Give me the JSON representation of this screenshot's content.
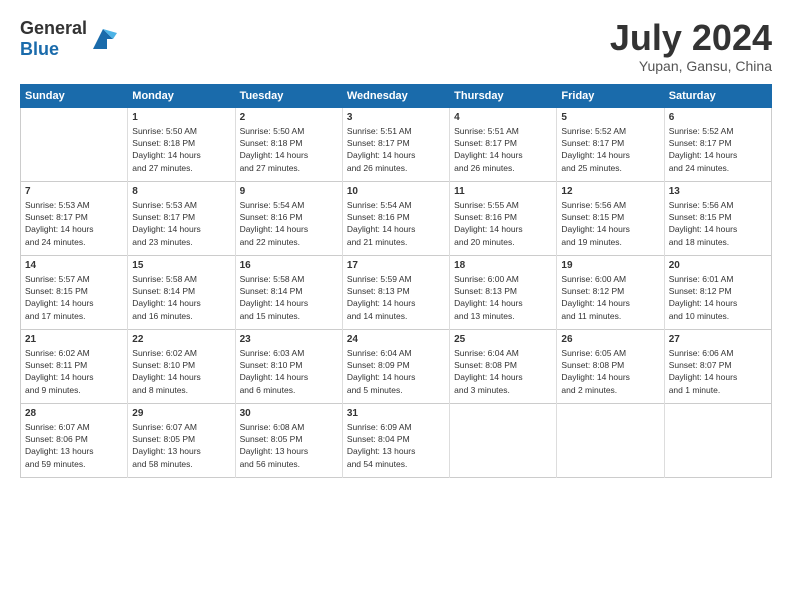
{
  "header": {
    "logo_general": "General",
    "logo_blue": "Blue",
    "month": "July 2024",
    "location": "Yupan, Gansu, China"
  },
  "weekdays": [
    "Sunday",
    "Monday",
    "Tuesday",
    "Wednesday",
    "Thursday",
    "Friday",
    "Saturday"
  ],
  "rows": [
    [
      {
        "day": "",
        "info": ""
      },
      {
        "day": "1",
        "info": "Sunrise: 5:50 AM\nSunset: 8:18 PM\nDaylight: 14 hours\nand 27 minutes."
      },
      {
        "day": "2",
        "info": "Sunrise: 5:50 AM\nSunset: 8:18 PM\nDaylight: 14 hours\nand 27 minutes."
      },
      {
        "day": "3",
        "info": "Sunrise: 5:51 AM\nSunset: 8:17 PM\nDaylight: 14 hours\nand 26 minutes."
      },
      {
        "day": "4",
        "info": "Sunrise: 5:51 AM\nSunset: 8:17 PM\nDaylight: 14 hours\nand 26 minutes."
      },
      {
        "day": "5",
        "info": "Sunrise: 5:52 AM\nSunset: 8:17 PM\nDaylight: 14 hours\nand 25 minutes."
      },
      {
        "day": "6",
        "info": "Sunrise: 5:52 AM\nSunset: 8:17 PM\nDaylight: 14 hours\nand 24 minutes."
      }
    ],
    [
      {
        "day": "7",
        "info": "Sunrise: 5:53 AM\nSunset: 8:17 PM\nDaylight: 14 hours\nand 24 minutes."
      },
      {
        "day": "8",
        "info": "Sunrise: 5:53 AM\nSunset: 8:17 PM\nDaylight: 14 hours\nand 23 minutes."
      },
      {
        "day": "9",
        "info": "Sunrise: 5:54 AM\nSunset: 8:16 PM\nDaylight: 14 hours\nand 22 minutes."
      },
      {
        "day": "10",
        "info": "Sunrise: 5:54 AM\nSunset: 8:16 PM\nDaylight: 14 hours\nand 21 minutes."
      },
      {
        "day": "11",
        "info": "Sunrise: 5:55 AM\nSunset: 8:16 PM\nDaylight: 14 hours\nand 20 minutes."
      },
      {
        "day": "12",
        "info": "Sunrise: 5:56 AM\nSunset: 8:15 PM\nDaylight: 14 hours\nand 19 minutes."
      },
      {
        "day": "13",
        "info": "Sunrise: 5:56 AM\nSunset: 8:15 PM\nDaylight: 14 hours\nand 18 minutes."
      }
    ],
    [
      {
        "day": "14",
        "info": "Sunrise: 5:57 AM\nSunset: 8:15 PM\nDaylight: 14 hours\nand 17 minutes."
      },
      {
        "day": "15",
        "info": "Sunrise: 5:58 AM\nSunset: 8:14 PM\nDaylight: 14 hours\nand 16 minutes."
      },
      {
        "day": "16",
        "info": "Sunrise: 5:58 AM\nSunset: 8:14 PM\nDaylight: 14 hours\nand 15 minutes."
      },
      {
        "day": "17",
        "info": "Sunrise: 5:59 AM\nSunset: 8:13 PM\nDaylight: 14 hours\nand 14 minutes."
      },
      {
        "day": "18",
        "info": "Sunrise: 6:00 AM\nSunset: 8:13 PM\nDaylight: 14 hours\nand 13 minutes."
      },
      {
        "day": "19",
        "info": "Sunrise: 6:00 AM\nSunset: 8:12 PM\nDaylight: 14 hours\nand 11 minutes."
      },
      {
        "day": "20",
        "info": "Sunrise: 6:01 AM\nSunset: 8:12 PM\nDaylight: 14 hours\nand 10 minutes."
      }
    ],
    [
      {
        "day": "21",
        "info": "Sunrise: 6:02 AM\nSunset: 8:11 PM\nDaylight: 14 hours\nand 9 minutes."
      },
      {
        "day": "22",
        "info": "Sunrise: 6:02 AM\nSunset: 8:10 PM\nDaylight: 14 hours\nand 8 minutes."
      },
      {
        "day": "23",
        "info": "Sunrise: 6:03 AM\nSunset: 8:10 PM\nDaylight: 14 hours\nand 6 minutes."
      },
      {
        "day": "24",
        "info": "Sunrise: 6:04 AM\nSunset: 8:09 PM\nDaylight: 14 hours\nand 5 minutes."
      },
      {
        "day": "25",
        "info": "Sunrise: 6:04 AM\nSunset: 8:08 PM\nDaylight: 14 hours\nand 3 minutes."
      },
      {
        "day": "26",
        "info": "Sunrise: 6:05 AM\nSunset: 8:08 PM\nDaylight: 14 hours\nand 2 minutes."
      },
      {
        "day": "27",
        "info": "Sunrise: 6:06 AM\nSunset: 8:07 PM\nDaylight: 14 hours\nand 1 minute."
      }
    ],
    [
      {
        "day": "28",
        "info": "Sunrise: 6:07 AM\nSunset: 8:06 PM\nDaylight: 13 hours\nand 59 minutes."
      },
      {
        "day": "29",
        "info": "Sunrise: 6:07 AM\nSunset: 8:05 PM\nDaylight: 13 hours\nand 58 minutes."
      },
      {
        "day": "30",
        "info": "Sunrise: 6:08 AM\nSunset: 8:05 PM\nDaylight: 13 hours\nand 56 minutes."
      },
      {
        "day": "31",
        "info": "Sunrise: 6:09 AM\nSunset: 8:04 PM\nDaylight: 13 hours\nand 54 minutes."
      },
      {
        "day": "",
        "info": ""
      },
      {
        "day": "",
        "info": ""
      },
      {
        "day": "",
        "info": ""
      }
    ]
  ]
}
